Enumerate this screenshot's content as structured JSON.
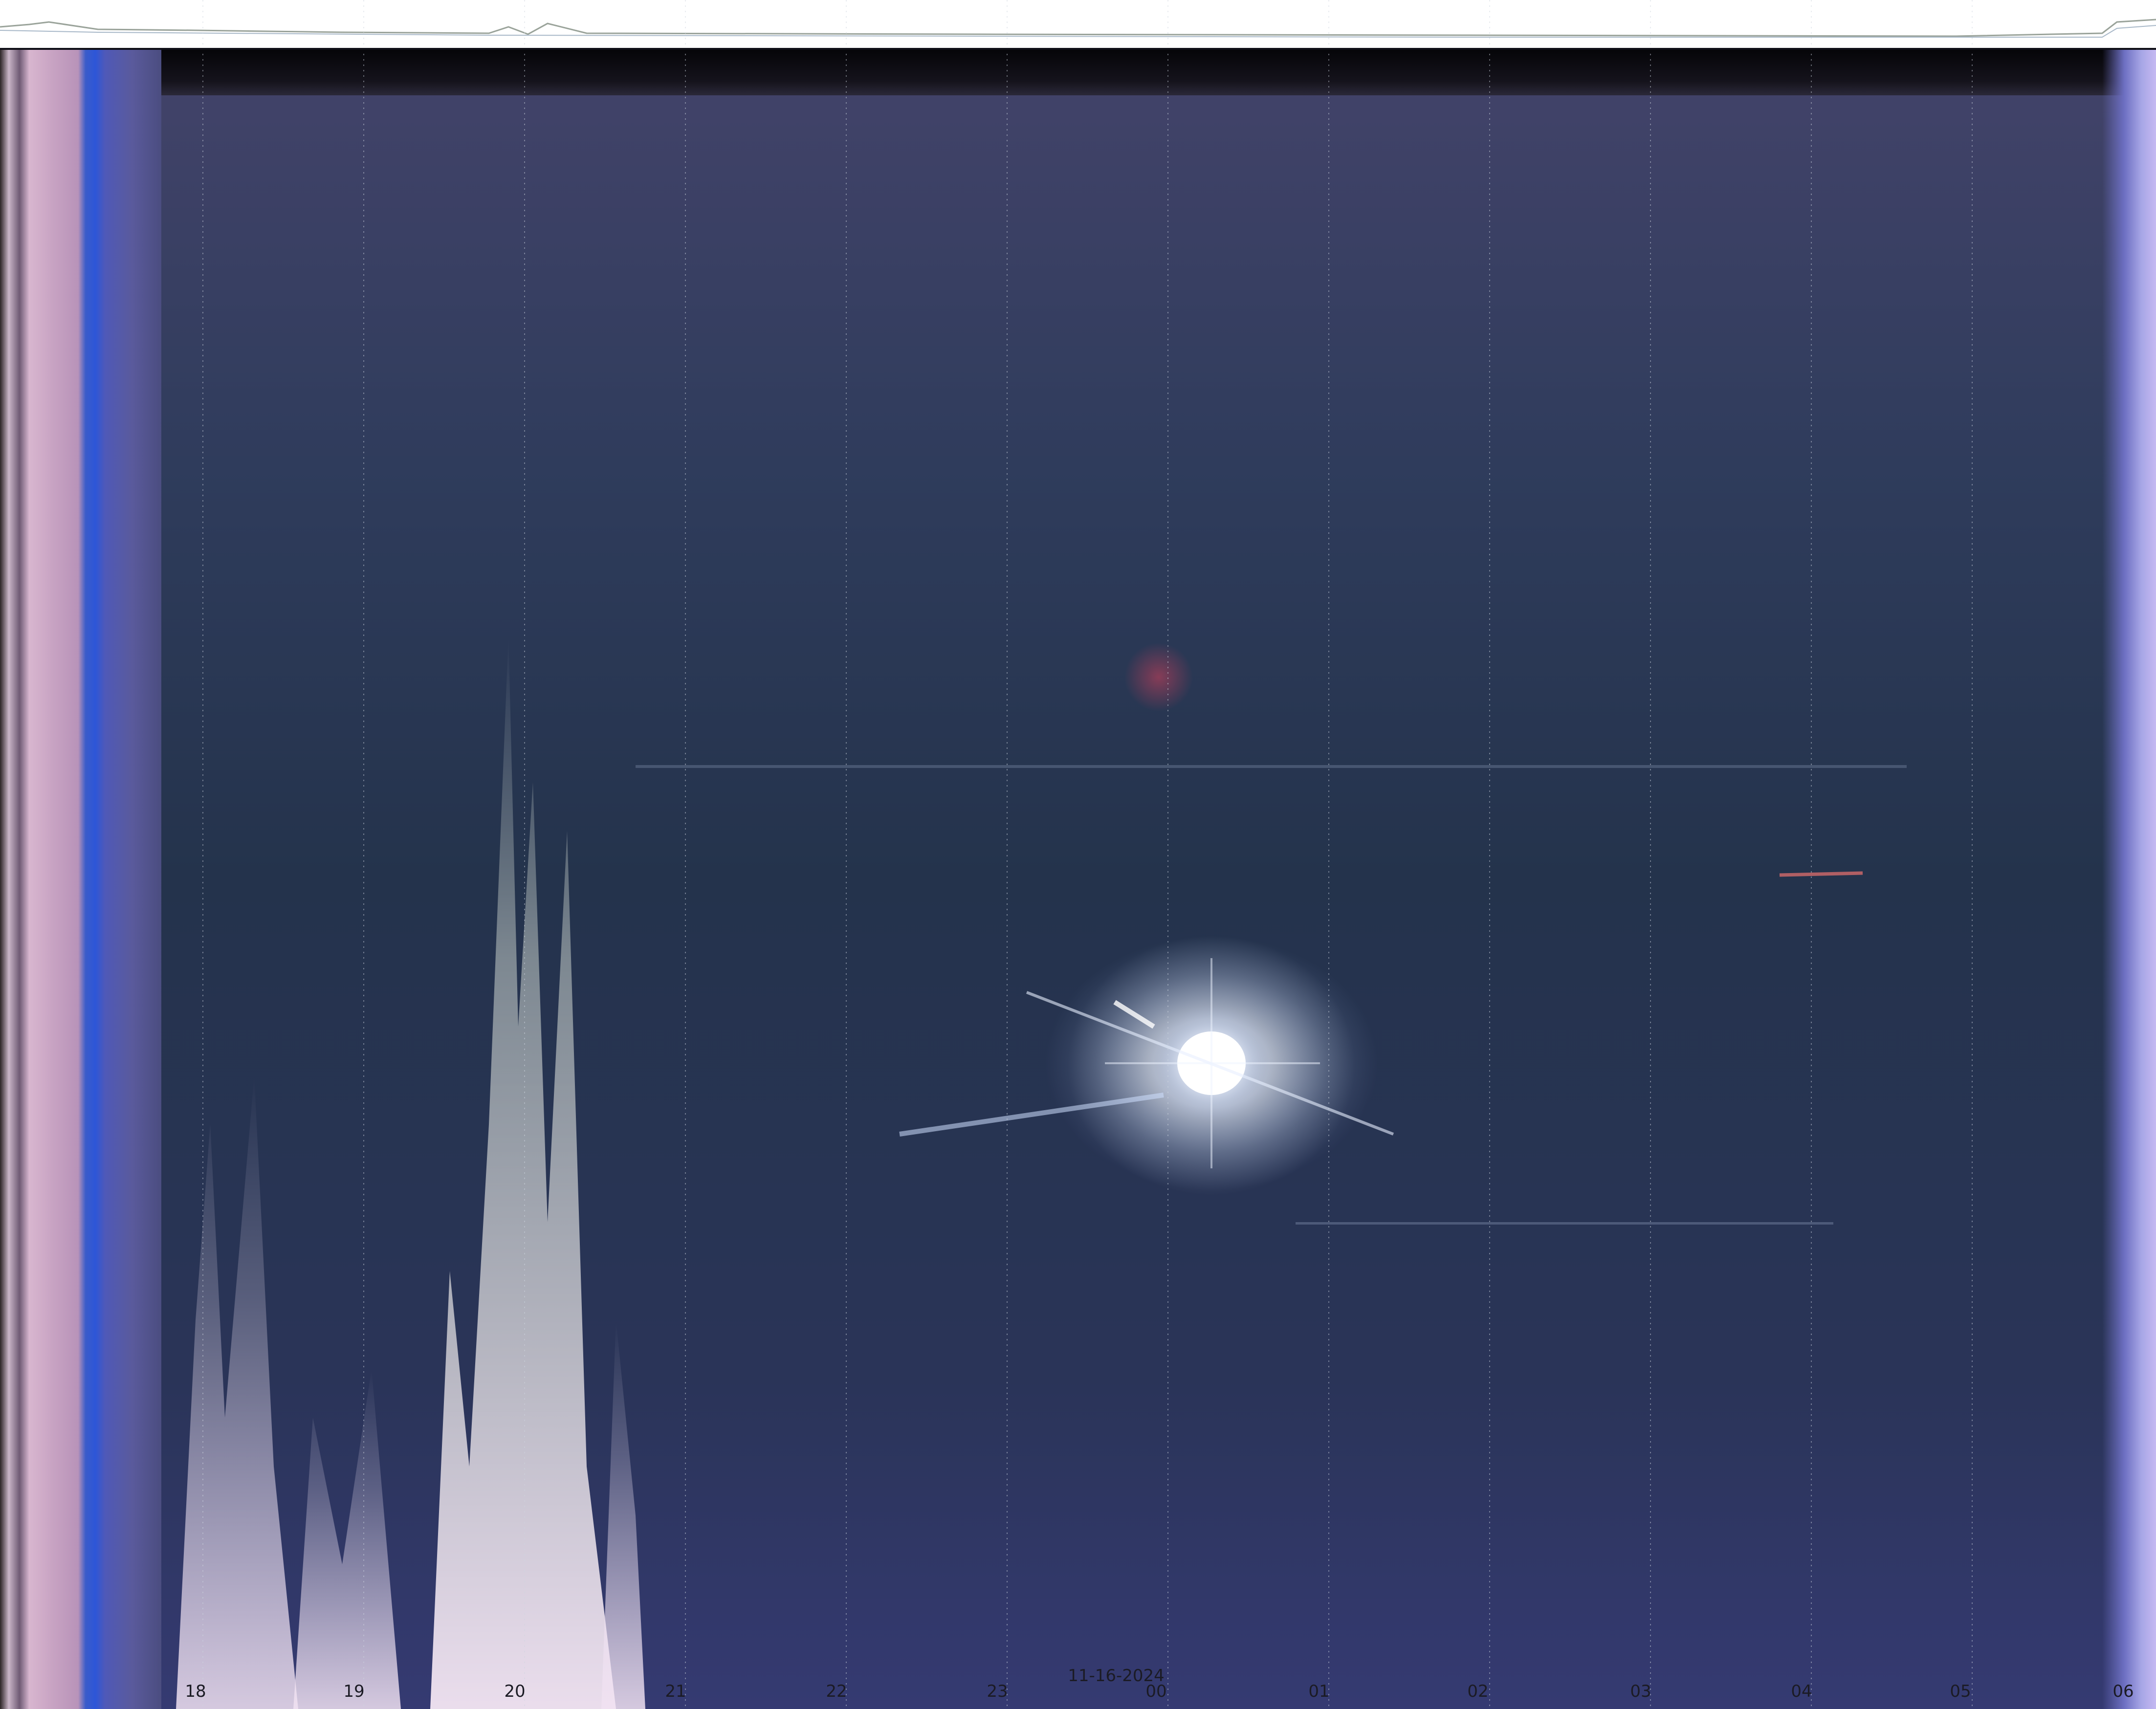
{
  "timeline": {
    "date": "11-16-2024",
    "hour_labels": [
      "18",
      "19",
      "20",
      "21",
      "22",
      "23",
      "00",
      "01",
      "02",
      "03",
      "04",
      "05",
      "06"
    ]
  },
  "colors": {
    "sky_top": "#43436a",
    "sky_mid": "#24334c",
    "sky_bottom": "#353a72",
    "label_text": "#1b1b24",
    "sun_glow": "#f4f8ff",
    "header_trace": "#9aa39a"
  }
}
